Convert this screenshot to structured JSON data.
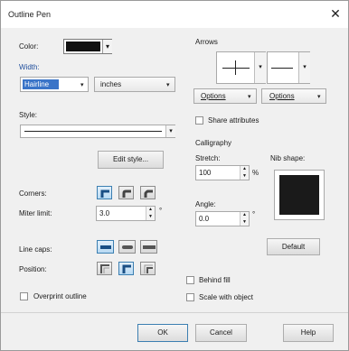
{
  "window": {
    "title": "Outline Pen",
    "close_glyph": "✕"
  },
  "color": {
    "label": "Color:",
    "value": "#111111",
    "dropdown_glyph": "▾"
  },
  "width": {
    "label": "Width:",
    "value": "Hairline",
    "units": "inches"
  },
  "style": {
    "label": "Style:",
    "edit_button": "Edit style..."
  },
  "corners": {
    "label": "Corners:",
    "selected_index": 0
  },
  "miter": {
    "label": "Miter limit:",
    "value": "3.0",
    "unit": "°"
  },
  "line_caps": {
    "label": "Line caps:",
    "selected_index": 0
  },
  "position": {
    "label": "Position:",
    "selected_index": 1
  },
  "overprint": {
    "label": "Overprint outline",
    "checked": false
  },
  "arrows": {
    "label": "Arrows",
    "options_left": "Options",
    "options_right": "Options"
  },
  "share_attributes": {
    "label": "Share attributes",
    "checked": false
  },
  "calligraphy": {
    "label": "Calligraphy",
    "stretch_label": "Stretch:",
    "stretch_value": "100",
    "stretch_unit": "%",
    "angle_label": "Angle:",
    "angle_value": "0.0",
    "angle_unit": "°",
    "nib_label": "Nib shape:",
    "default_button": "Default"
  },
  "behind_fill": {
    "label": "Behind fill",
    "checked": false
  },
  "scale_with_object": {
    "label": "Scale with object",
    "checked": false
  },
  "buttons": {
    "ok": "OK",
    "cancel": "Cancel",
    "help": "Help"
  }
}
